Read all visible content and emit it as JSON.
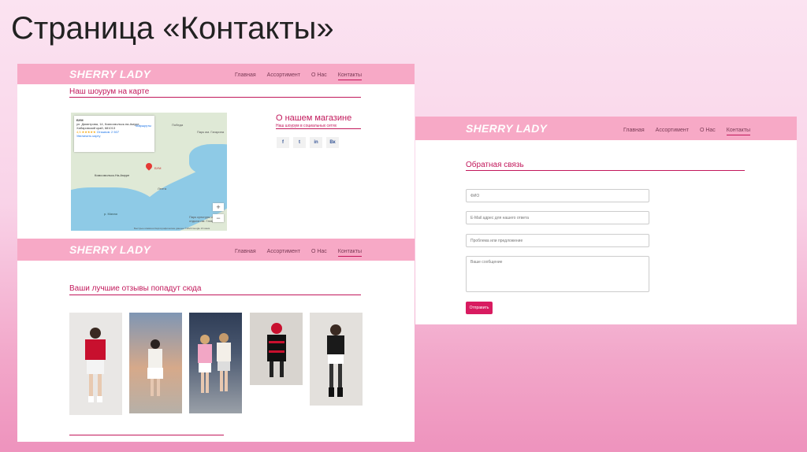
{
  "slide": {
    "title": "Страница «Контакты»"
  },
  "brand": {
    "logo": "SHERRY LADY",
    "accent": "#c2185b",
    "header_bg": "#f7a9c6"
  },
  "nav": {
    "home": "Главная",
    "assortment": "Ассортимент",
    "about": "О Нас",
    "contacts": "Контакты"
  },
  "map_section": {
    "title": "Наш шоурум на карте",
    "card": {
      "name": "БУМ",
      "address": "ул. Димитрова, 14, Комсомольск-на-Амуре, Хабаровский край, 681013",
      "rating": "4,5 ★★★★★",
      "reviews": "Отзывов: 2 507",
      "route": "Маршруты",
      "bigger": "Увеличить карту"
    },
    "labels": {
      "pin": "БУМ",
      "city": "Комсомольск-На-Амуре",
      "place1": "Победа",
      "place2": "Парк им. Гагарина",
      "place3": "Лента",
      "place4": "Парк культуры и отдыха им. Гагарина",
      "river": "р. Малая",
      "footer": "Быстрые клавиши   Картографические данные ©2023 Google   Условия"
    },
    "zoom_in": "+",
    "zoom_out": "−"
  },
  "about_store": {
    "title": "О нашем магазине",
    "subtitle": "Наш шоурум в социальных сетях",
    "icons": [
      "f",
      "t",
      "in",
      "Вк"
    ]
  },
  "reviews_section": {
    "title": "Ваши лучшие отзывы попадут сюда"
  },
  "feedback": {
    "title": "Обратная связь",
    "name_placeholder": "ФИО",
    "email_placeholder": "E-Mail адрес для нашего ответа",
    "problem_placeholder": "Проблема или предложение",
    "message_placeholder": "Ваше сообщение",
    "submit": "Отправить"
  }
}
